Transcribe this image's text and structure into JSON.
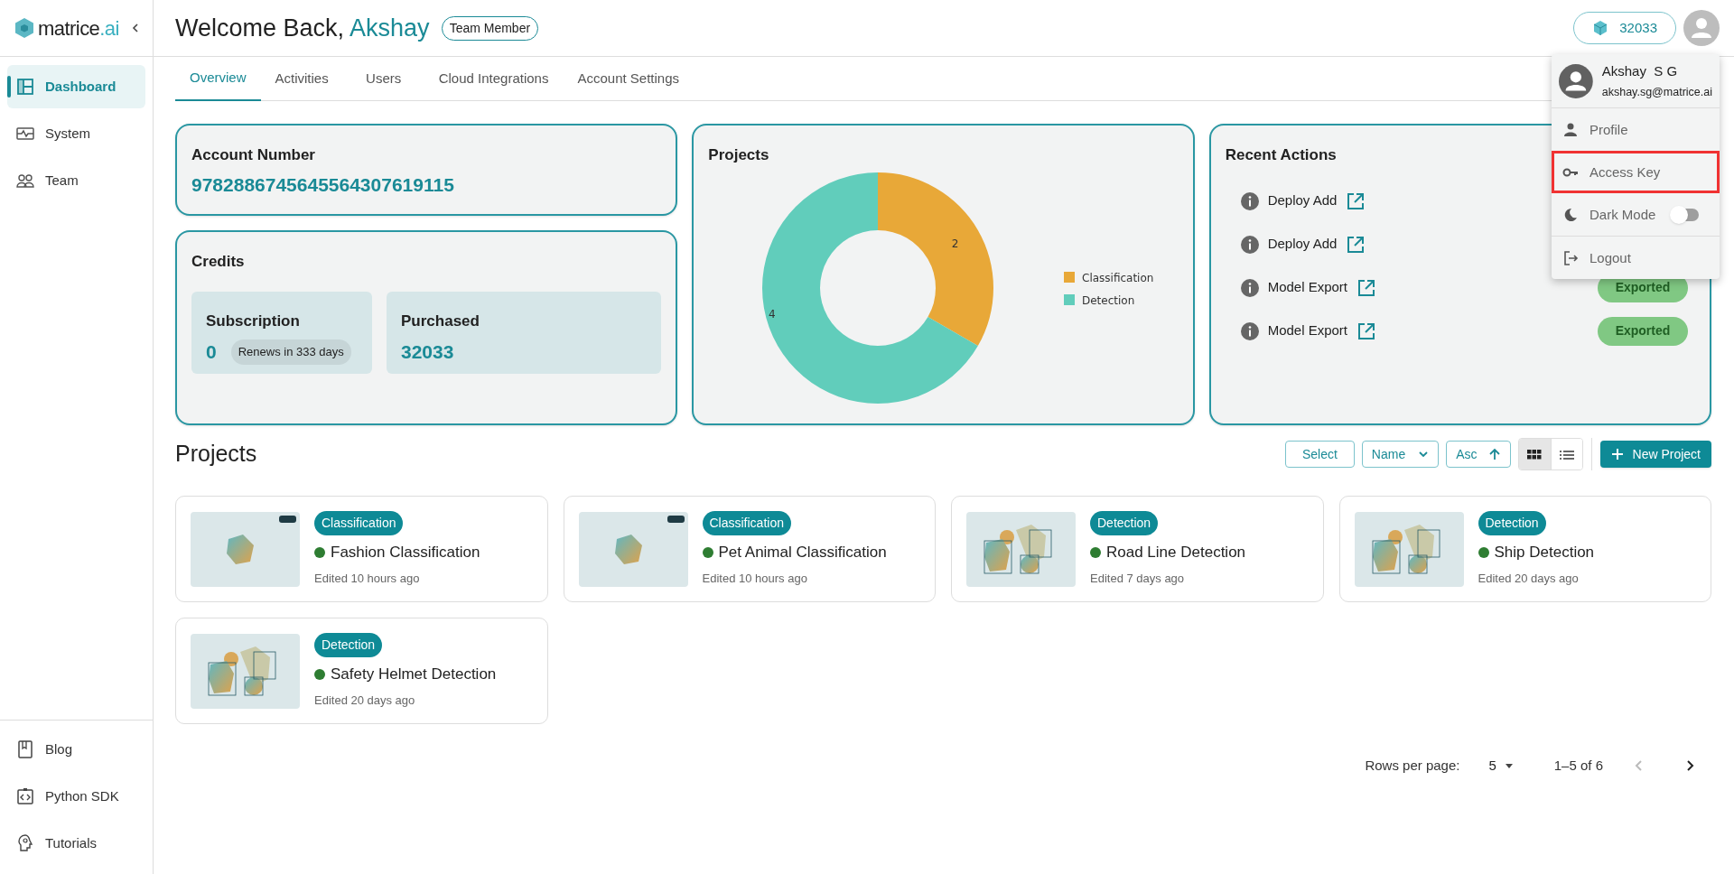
{
  "sidebar": {
    "logo": {
      "text": "matrice",
      "accent": ".ai"
    },
    "items": [
      {
        "label": "Dashboard",
        "selected": true
      },
      {
        "label": "System",
        "selected": false
      },
      {
        "label": "Team",
        "selected": false
      }
    ],
    "bottom_items": [
      {
        "label": "Blog"
      },
      {
        "label": "Python SDK"
      },
      {
        "label": "Tutorials"
      }
    ]
  },
  "header": {
    "greeting": "Welcome Back,",
    "user_name": "Akshay",
    "role_badge": "Team Member",
    "credits": "32033"
  },
  "tabs": [
    {
      "label": "Overview",
      "selected": true
    },
    {
      "label": "Activities",
      "selected": false
    },
    {
      "label": "Users",
      "selected": false
    },
    {
      "label": "Cloud Integrations",
      "selected": false
    },
    {
      "label": "Account Settings",
      "selected": false
    }
  ],
  "account": {
    "title": "Account Number",
    "number": "9782886745645564307619115"
  },
  "credits": {
    "title": "Credits",
    "subscription": {
      "label": "Subscription",
      "value": "0",
      "note": "Renews in 333 days"
    },
    "purchased": {
      "label": "Purchased",
      "value": "32033"
    }
  },
  "projects_chart": {
    "title": "Projects",
    "chart_data": {
      "type": "donut",
      "categories": [
        "Classification",
        "Detection"
      ],
      "colors": [
        "#e8a838",
        "#61cdbb"
      ],
      "values": [
        2,
        4
      ],
      "legend": "right",
      "data_labels": true
    }
  },
  "recent_actions": {
    "title": "Recent Actions",
    "items": [
      {
        "label": "Deploy Add"
      },
      {
        "label": "Deploy Add"
      },
      {
        "label": "Model Export",
        "status": "Exported"
      },
      {
        "label": "Model Export",
        "status": "Exported"
      }
    ]
  },
  "projects": {
    "title": "Projects",
    "toolbar": {
      "select": "Select",
      "sort": "Name",
      "order": "Asc",
      "view_modes": [
        {
          "selected": true
        },
        {
          "selected": false
        }
      ],
      "new_button": "New Project"
    },
    "cards": [
      {
        "kind": "single",
        "type": "Classification",
        "name": "Fashion Classification",
        "edited": "Edited 10 hours ago"
      },
      {
        "kind": "single",
        "type": "Classification",
        "name": "Pet Animal Classification",
        "edited": "Edited 10 hours ago"
      },
      {
        "kind": "multi",
        "type": "Detection",
        "name": "Road Line Detection",
        "edited": "Edited 7 days ago"
      },
      {
        "kind": "multi",
        "type": "Detection",
        "name": "Ship Detection",
        "edited": "Edited 20 days ago"
      },
      {
        "kind": "multi",
        "type": "Detection",
        "name": "Safety Helmet Detection",
        "edited": "Edited 20 days ago"
      }
    ]
  },
  "pagination": {
    "rows_label": "Rows per page:",
    "rows_value": "5",
    "range": "1–5 of 6",
    "prev_disabled": true,
    "next_disabled": false
  },
  "user_menu": {
    "name": "Akshay  S G",
    "email": "akshay.sg@matrice.ai",
    "items": [
      {
        "kind": "link",
        "label": "Profile",
        "highlighted": false
      },
      {
        "kind": "link",
        "label": "Access Key",
        "highlighted": true
      },
      {
        "kind": "toggle",
        "label": "Dark Mode",
        "on": false,
        "highlighted": false
      },
      {
        "kind": "link",
        "label": "Logout",
        "highlighted": false
      }
    ]
  }
}
